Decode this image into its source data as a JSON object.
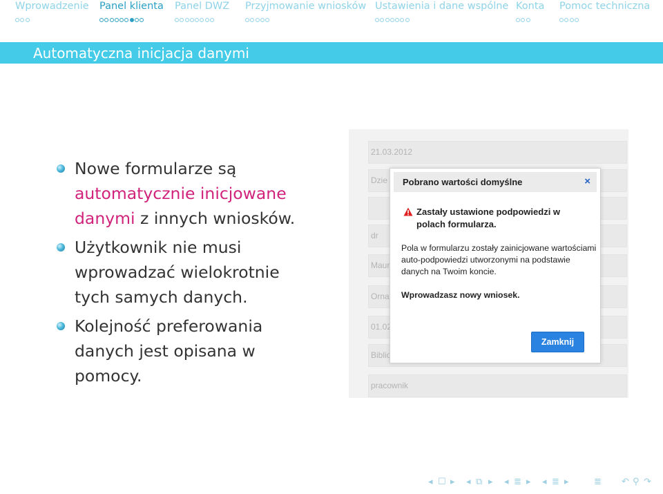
{
  "nav": {
    "sections": [
      {
        "label": "Wprowadzenie",
        "dots": 3,
        "current": -1,
        "active": false
      },
      {
        "label": "Panel klienta",
        "dots": 9,
        "current": 6,
        "active": true
      },
      {
        "label": "Panel DWZ",
        "dots": 8,
        "current": -1,
        "active": false
      },
      {
        "label": "Przyjmowanie wniosków",
        "dots": 5,
        "current": -1,
        "active": false
      },
      {
        "label": "Ustawienia i dane wspólne",
        "dots": 7,
        "current": -1,
        "active": false
      },
      {
        "label": "Konta",
        "dots": 3,
        "current": -1,
        "active": false
      },
      {
        "label": "Pomoc techniczna",
        "dots": 4,
        "current": -1,
        "active": false
      }
    ]
  },
  "frame": {
    "title": "Automatyczna inicjacja danymi"
  },
  "bullets": {
    "b1_pre": "Nowe formularze są ",
    "b1_accent": "automatycznie inicjowane danymi",
    "b1_post": " z innych wniosków.",
    "b2": "Użytkownik nie musi wprowadzać wielokrotnie tych samych danych.",
    "b3": "Kolejność preferowania danych jest opisana w pomocy."
  },
  "screenshot": {
    "fields": [
      "21.03.2012",
      "Dzie",
      "",
      "dr",
      "Maur",
      "Orna",
      "01.02",
      "Biblio",
      "pracownik"
    ],
    "dialog": {
      "title": "Pobrano wartości domyślne",
      "close": "×",
      "warning": "Zastały ustawione podpowiedzi w polach formularza.",
      "body": "Pola w formularzu zostały zainicjowane wartościami auto-podpowiedzi utworzonymi na podstawie danych na Twoim koncie.",
      "body_bold": "Wprowadzasz nowy wniosek.",
      "button": "Zamknij"
    }
  },
  "beamer_nav": {
    "prev_slide": "◂",
    "slide_icon": "☐",
    "next_slide": "▸",
    "prev_frame": "◂",
    "frame_icon": "⧉",
    "next_frame": "▸",
    "prev_sub": "◂",
    "sub_icon": "≣",
    "next_sub": "▸",
    "prev_sec": "◂",
    "sec_icon": "≣",
    "next_sec": "▸",
    "toc_icon": "≣",
    "back_icon": "↶",
    "search_icon": "⚲",
    "forward_icon": "↷"
  },
  "colors": {
    "accent": "#d1237b",
    "title_bar": "#43cbe8",
    "nav_active": "#2a9fc4",
    "nav_inactive": "#8fd3e8",
    "button": "#2a83e0"
  }
}
